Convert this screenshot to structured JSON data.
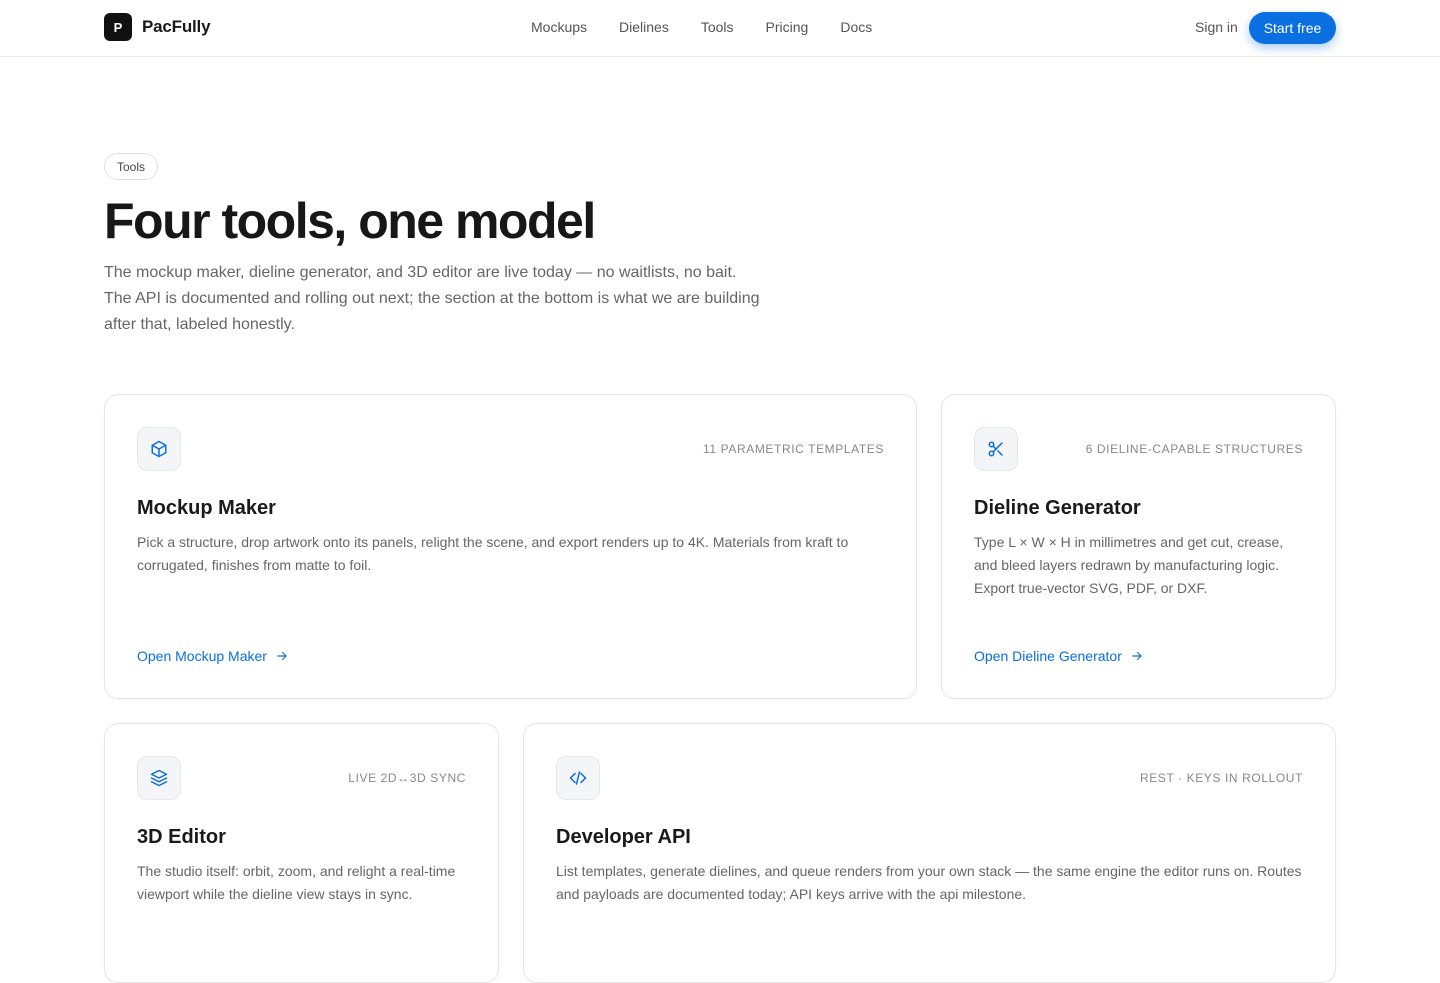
{
  "nav": {
    "logo_letter": "P",
    "brand": "PacFully",
    "links": [
      "Mockups",
      "Dielines",
      "Tools",
      "Pricing",
      "Docs"
    ],
    "sign_in": "Sign in",
    "cta": "Start free"
  },
  "hero": {
    "pill": "Tools",
    "title": "Four tools, one model",
    "subtitle": "The mockup maker, dieline generator, and 3D editor are live today — no waitlists, no bait. The API is documented and rolling out next; the section at the bottom is what we are building after that, labeled honestly."
  },
  "cards": [
    {
      "icon": "cube-icon",
      "tag": "11 PARAMETRIC TEMPLATES",
      "title": "Mockup Maker",
      "desc": "Pick a structure, drop artwork onto its panels, relight the scene, and export renders up to 4K. Materials from kraft to corrugated, finishes from matte to foil.",
      "link": "Open Mockup Maker"
    },
    {
      "icon": "scissors-icon",
      "tag": "6 DIELINE-CAPABLE STRUCTURES",
      "title": "Dieline Generator",
      "desc": "Type L × W × H in millimetres and get cut, crease, and bleed layers redrawn by manufacturing logic. Export true-vector SVG, PDF, or DXF.",
      "link": "Open Dieline Generator"
    },
    {
      "icon": "layers-icon",
      "tag": "LIVE 2D↔3D SYNC",
      "title": "3D Editor",
      "desc": "The studio itself: orbit, zoom, and relight a real-time viewport while the dieline view stays in sync."
    },
    {
      "icon": "code-icon",
      "tag": "REST · KEYS IN ROLLOUT",
      "title": "Developer API",
      "desc": "List templates, generate dielines, and queue renders from your own stack — the same engine the editor runs on. Routes and payloads are documented today; API keys arrive with the api milestone."
    }
  ],
  "colors": {
    "accent": "#0a6fe0",
    "text": "#1a1a1a",
    "muted": "#666666",
    "border": "#e6e6e6"
  }
}
